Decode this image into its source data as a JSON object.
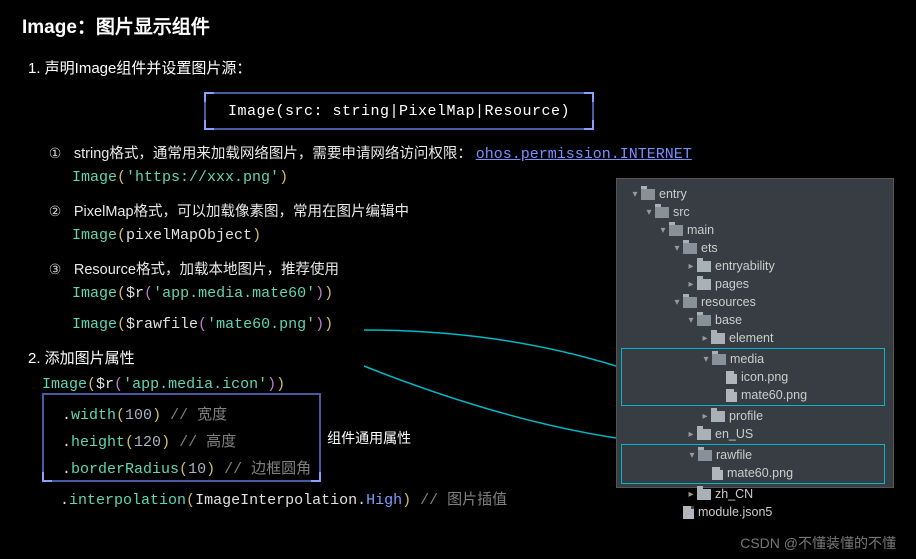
{
  "title": "Image：图片显示组件",
  "sections": {
    "s1_label": "1. 声明Image组件并设置图片源：",
    "signature": "Image(src: string|PixelMap|Resource)",
    "items": [
      {
        "num": "①",
        "desc_a": "string格式，通常用来加载网络图片，需要申请网络访问权限：",
        "perm": "ohos.permission.INTERNET",
        "code_prefix": "Image",
        "code_arg": "'https://xxx.png'"
      },
      {
        "num": "②",
        "desc_a": "PixelMap格式，可以加载像素图，常用在图片编辑中",
        "code_prefix": "Image",
        "code_ident": "pixelMapObject"
      },
      {
        "num": "③",
        "desc_a": "Resource格式，加载本地图片，推荐使用",
        "code_a_prefix": "Image",
        "code_a_fn": "$r",
        "code_a_arg": "'app.media.mate60'",
        "code_b_prefix": "Image",
        "code_b_fn": "$rawfile",
        "code_b_arg": "'mate60.png'"
      }
    ],
    "s2_label": "2. 添加图片属性",
    "attr_code_head": {
      "prefix": "Image",
      "fn": "$r",
      "arg": "'app.media.icon'"
    },
    "attr_lines": [
      {
        "fn": "width",
        "arg": "100",
        "cmt": "// 宽度"
      },
      {
        "fn": "height",
        "arg": "120",
        "cmt": "// 高度"
      },
      {
        "fn": "borderRadius",
        "arg": "10",
        "cmt": "// 边框圆角"
      }
    ],
    "attr_box_label": "组件通用属性",
    "interp_line": {
      "fn": "interpolation",
      "cls": "ImageInterpolation",
      "prop": "High",
      "cmt": "// 图片插值"
    }
  },
  "tree": {
    "rows": [
      {
        "pad": 8,
        "tw": "▾",
        "icon": "folder-open",
        "label": "entry"
      },
      {
        "pad": 22,
        "tw": "▾",
        "icon": "folder-open",
        "label": "src"
      },
      {
        "pad": 36,
        "tw": "▾",
        "icon": "folder-open",
        "label": "main"
      },
      {
        "pad": 50,
        "tw": "▾",
        "icon": "folder-open",
        "label": "ets"
      },
      {
        "pad": 64,
        "tw": "▸",
        "icon": "folder",
        "label": "entryability"
      },
      {
        "pad": 64,
        "tw": "▸",
        "icon": "folder",
        "label": "pages"
      },
      {
        "pad": 50,
        "tw": "▾",
        "icon": "folder-open",
        "label": "resources"
      },
      {
        "pad": 64,
        "tw": "▾",
        "icon": "folder-open",
        "label": "base"
      },
      {
        "pad": 78,
        "tw": "▸",
        "icon": "folder",
        "label": "element"
      }
    ],
    "media_group": {
      "head": {
        "pad": 78,
        "tw": "▾",
        "icon": "folder-open",
        "label": "media"
      },
      "files": [
        {
          "pad": 92,
          "icon": "file",
          "label": "icon.png"
        },
        {
          "pad": 92,
          "icon": "file",
          "label": "mate60.png"
        }
      ]
    },
    "rows2": [
      {
        "pad": 78,
        "tw": "▸",
        "icon": "folder",
        "label": "profile"
      },
      {
        "pad": 64,
        "tw": "▸",
        "icon": "folder",
        "label": "en_US"
      }
    ],
    "rawfile_group": {
      "head": {
        "pad": 64,
        "tw": "▾",
        "icon": "folder-open",
        "label": "rawfile"
      },
      "files": [
        {
          "pad": 78,
          "icon": "file",
          "label": "mate60.png"
        }
      ]
    },
    "rows3": [
      {
        "pad": 64,
        "tw": "▸",
        "icon": "folder",
        "label": "zh_CN"
      },
      {
        "pad": 50,
        "tw": "",
        "icon": "file",
        "label": "module.json5"
      }
    ]
  },
  "watermark": "CSDN @不懂装懂的不懂"
}
